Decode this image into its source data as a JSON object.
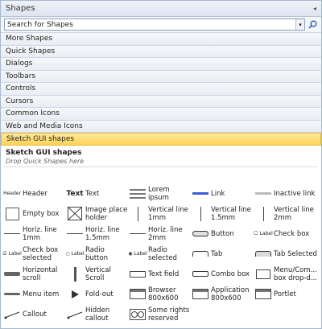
{
  "panel": {
    "title": "Shapes",
    "collapse_glyph": "◂"
  },
  "search": {
    "placeholder": "Search for Shapes",
    "value": "Search for Shapes"
  },
  "categories": [
    "More Shapes",
    "Quick Shapes",
    "Dialogs",
    "Toolbars",
    "Controls",
    "Cursors",
    "Common Icons",
    "Web and Media Icons",
    "Sketch GUI shapes"
  ],
  "stencil": {
    "title": "Sketch GUI shapes",
    "hint": "Drop Quick Shapes here"
  },
  "shapes": [
    {
      "label": "Header",
      "icon": "header-icon",
      "thumb_text": "Header"
    },
    {
      "label": "Text",
      "icon": "text-icon",
      "thumb_text": "Text"
    },
    {
      "label": "Lorem ipsum",
      "icon": "lorem-icon"
    },
    {
      "label": "Link",
      "icon": "link-icon"
    },
    {
      "label": "Inactive link",
      "icon": "inactive-link-icon"
    },
    {
      "label": "Empty box",
      "icon": "empty-box-icon"
    },
    {
      "label": "Image place holder",
      "icon": "image-placeholder-icon"
    },
    {
      "label": "Vertical line 1mm",
      "icon": "vertical-line-icon"
    },
    {
      "label": "Vertical line 1.5mm",
      "icon": "vertical-line-icon"
    },
    {
      "label": "Vertical line 2mm",
      "icon": "vertical-line-icon"
    },
    {
      "label": "Horiz. line 1mm",
      "icon": "horizontal-line-icon"
    },
    {
      "label": "Horiz. line 1.5mm",
      "icon": "horizontal-line-icon"
    },
    {
      "label": "Horiz. line 2mm",
      "icon": "horizontal-line-icon"
    },
    {
      "label": "Button",
      "icon": "button-icon"
    },
    {
      "label": "Check box",
      "icon": "checkbox-icon",
      "thumb_text": "☐ Label"
    },
    {
      "label": "Check box selected",
      "icon": "checkbox-selected-icon",
      "thumb_text": "☑ Label"
    },
    {
      "label": "Radio button",
      "icon": "radio-icon",
      "thumb_text": "○ Label"
    },
    {
      "label": "Radio selected",
      "icon": "radio-selected-icon",
      "thumb_text": "◉ Label"
    },
    {
      "label": "Tab",
      "icon": "tab-icon"
    },
    {
      "label": "Tab  Selected",
      "icon": "tab-selected-icon"
    },
    {
      "label": "Horizontal scroll",
      "icon": "horizontal-scroll-icon"
    },
    {
      "label": "Vertical Scroll",
      "icon": "vertical-scroll-icon"
    },
    {
      "label": "Text field",
      "icon": "text-field-icon"
    },
    {
      "label": "Combo box",
      "icon": "combo-box-icon"
    },
    {
      "label": "Menu/Com... box drop-d...",
      "icon": "menu-icon"
    },
    {
      "label": "Menu item",
      "icon": "menu-item-icon"
    },
    {
      "label": "Fold-out",
      "icon": "fold-out-icon"
    },
    {
      "label": "Browser 800x600",
      "icon": "browser-icon"
    },
    {
      "label": "Application 800x600",
      "icon": "application-icon"
    },
    {
      "label": "Portlet",
      "icon": "portlet-icon"
    },
    {
      "label": "Callout",
      "icon": "callout-icon"
    },
    {
      "label": "Hidden callout",
      "icon": "hidden-callout-icon"
    },
    {
      "label": "Some rights reserved",
      "icon": "rights-icon"
    }
  ]
}
